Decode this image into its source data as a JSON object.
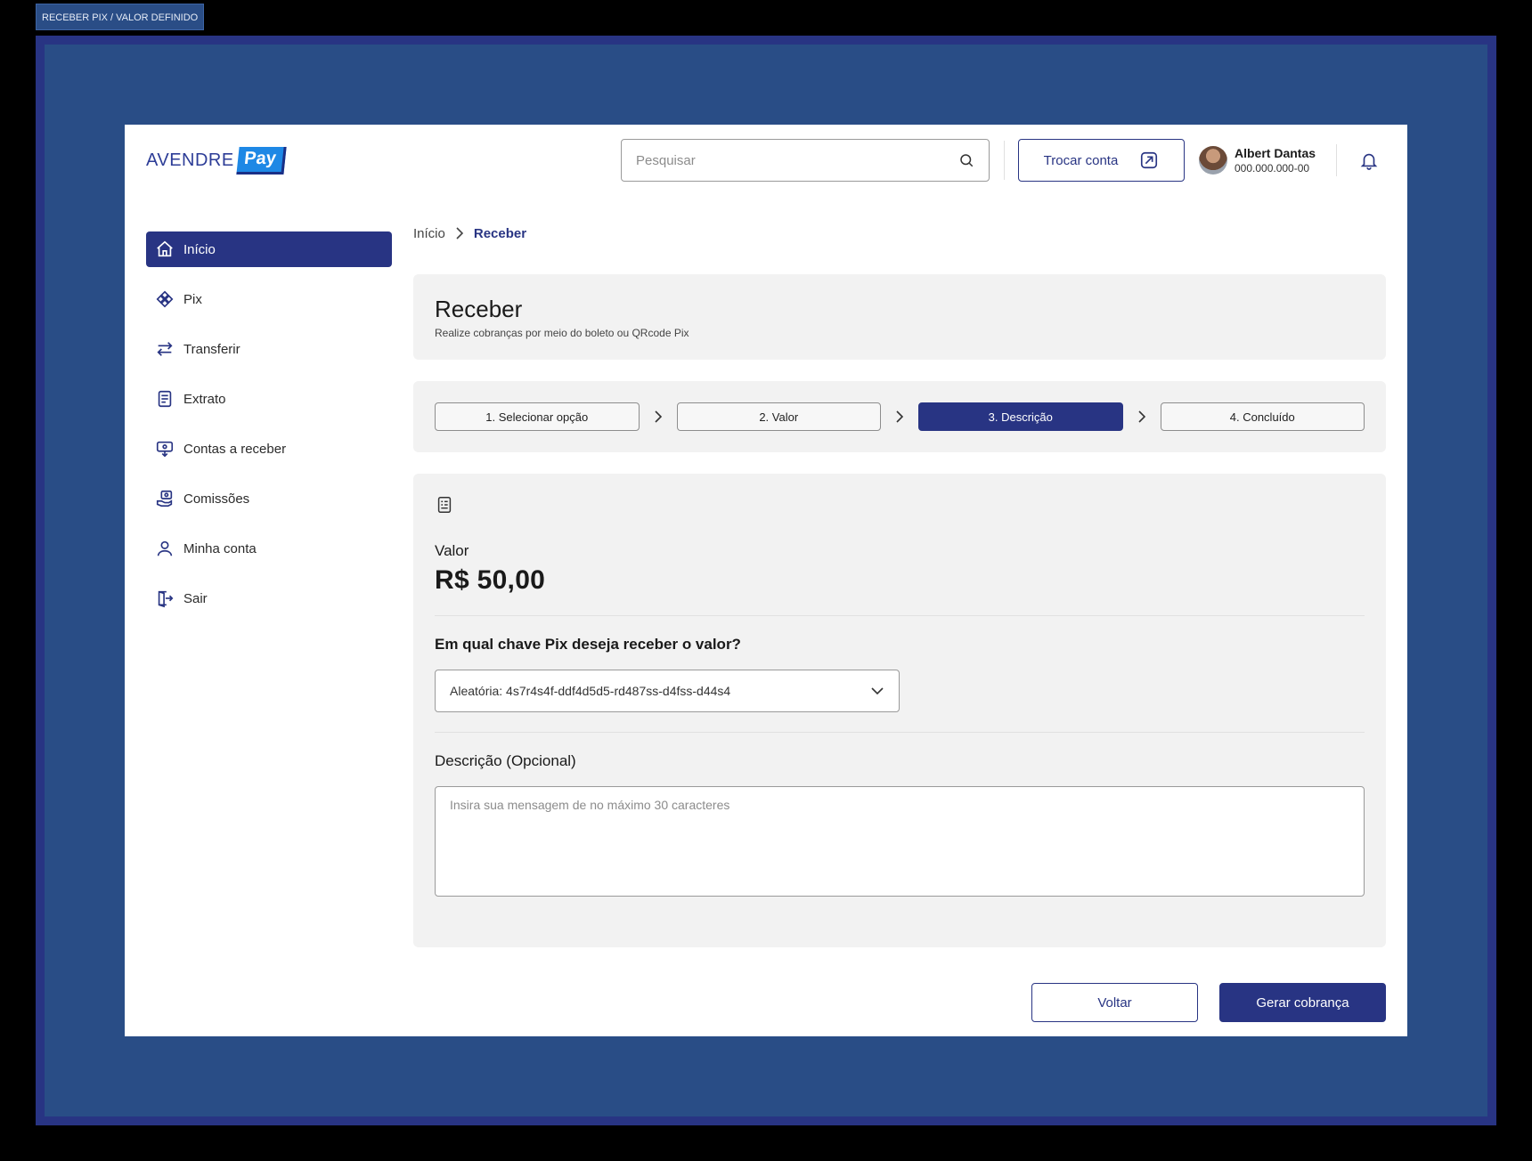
{
  "frame_label": "RECEBER PIX / VALOR DEFINIDO",
  "brand": {
    "name": "AVENDRE",
    "pay": "Pay"
  },
  "header": {
    "search_placeholder": "Pesquisar",
    "switch_account_label": "Trocar conta",
    "user_name": "Albert Dantas",
    "user_doc": "000.000.000-00"
  },
  "sidebar": {
    "items": [
      {
        "label": "Início",
        "icon": "home-icon",
        "active": true
      },
      {
        "label": "Pix",
        "icon": "pix-icon"
      },
      {
        "label": "Transferir",
        "icon": "transfer-icon"
      },
      {
        "label": "Extrato",
        "icon": "statement-icon"
      },
      {
        "label": "Contas a receber",
        "icon": "receivables-icon"
      },
      {
        "label": "Comissões",
        "icon": "commission-icon"
      },
      {
        "label": "Minha conta",
        "icon": "user-icon"
      },
      {
        "label": "Sair",
        "icon": "logout-icon"
      }
    ]
  },
  "breadcrumb": {
    "home": "Início",
    "current": "Receber"
  },
  "page": {
    "title": "Receber",
    "subtitle": "Realize cobranças por meio do boleto ou QRcode Pix"
  },
  "steps": [
    {
      "label": "1. Selecionar opção"
    },
    {
      "label": "2. Valor"
    },
    {
      "label": "3. Descrição",
      "active": true
    },
    {
      "label": "4. Concluído"
    }
  ],
  "form": {
    "valor_label": "Valor",
    "valor_amount": "R$ 50,00",
    "pix_question": "Em qual chave Pix deseja receber o valor?",
    "pix_key_selected": "Aleatória: 4s7r4s4f-ddf4d5d5-rd487ss-d4fss-d44s4",
    "description_label": "Descrição (Opcional)",
    "description_placeholder": "Insira sua mensagem de no máximo 30 caracteres"
  },
  "actions": {
    "back_label": "Voltar",
    "generate_label": "Gerar cobrança"
  },
  "colors": {
    "primary": "#283483",
    "frame_bg": "#294d86",
    "card_bg": "#f2f2f2"
  }
}
